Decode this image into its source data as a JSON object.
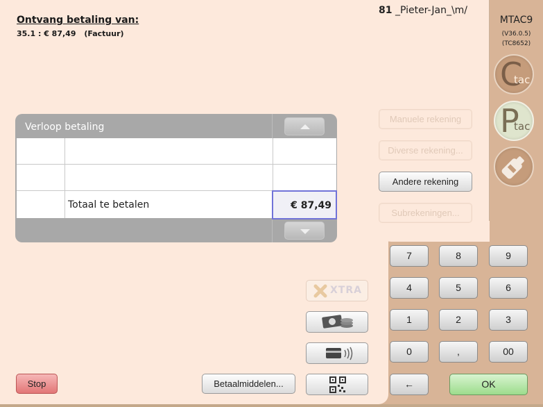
{
  "header": {
    "title": "Ontvang betaling van:",
    "invoice_ref": "35.1 : € 87,49",
    "invoice_type": "(Factuur)",
    "user_id": "81",
    "user_name": "_Pieter-Jan_\\m/"
  },
  "sidebar": {
    "app_name": "MTAC9",
    "version": "(V36.0.5)",
    "build": "(TC8652)",
    "ctac_big": "C",
    "ctac_small": "tac",
    "ptac_big": "P",
    "ptac_small": "tac"
  },
  "payment_table": {
    "title": "Verloop betaling",
    "total_label": "Totaal te betalen",
    "total_amount": "€ 87,49"
  },
  "actions": {
    "manual_account": "Manuele rekening",
    "misc_account": "Diverse rekening...",
    "other_account": "Andere rekening",
    "sub_accounts": "Subrekeningen...",
    "stop": "Stop",
    "payment_methods": "Betaalmiddelen...",
    "xtra_label": "XTRA"
  },
  "keypad": {
    "keys": [
      "7",
      "8",
      "9",
      "4",
      "5",
      "6",
      "1",
      "2",
      "3",
      "0",
      ",",
      "00"
    ],
    "backspace": "←",
    "ok": "OK"
  },
  "colors": {
    "panel": "#fde9dc",
    "keypad_bg": "#d8b497",
    "focus_border": "#7073d8",
    "stop": "#e27676",
    "ok": "#9ddc8c"
  }
}
